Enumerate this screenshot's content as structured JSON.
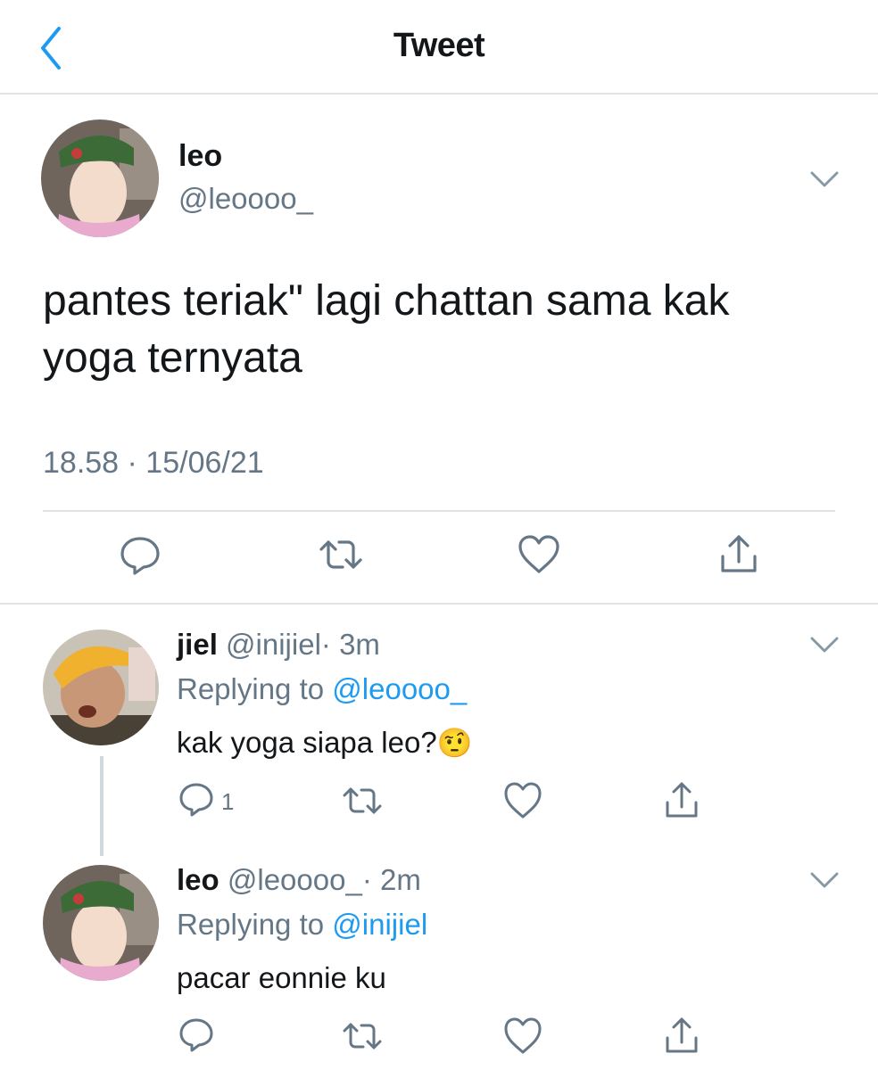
{
  "header": {
    "title": "Tweet"
  },
  "main_tweet": {
    "display_name": "leo",
    "handle": "@leoooo_",
    "text_line1": "pantes teriak\" lagi chattan sama kak",
    "text_line2": "yoga ternyata",
    "timestamp": "18.58 · 15/06/21"
  },
  "replies": [
    {
      "display_name": "jiel",
      "handle": "@inijiel",
      "age": "· 3m",
      "replying_label": "Replying to",
      "replying_to": "@leoooo_",
      "text": "kak yoga siapa leo?",
      "emoji": "🤨",
      "reply_count": "1"
    },
    {
      "display_name": "leo",
      "handle": "@leoooo_",
      "age": "· 2m",
      "replying_label": "Replying to",
      "replying_to": "@inijiel",
      "text": "pacar eonnie ku"
    }
  ],
  "icons": [
    "back-chevron-icon",
    "chevron-down-icon",
    "reply-icon",
    "retweet-icon",
    "like-icon",
    "share-icon"
  ],
  "colors": {
    "accent": "#1d9bf0",
    "muted": "#657786",
    "divider": "#e1e4e7",
    "action_icon": "#657786"
  }
}
